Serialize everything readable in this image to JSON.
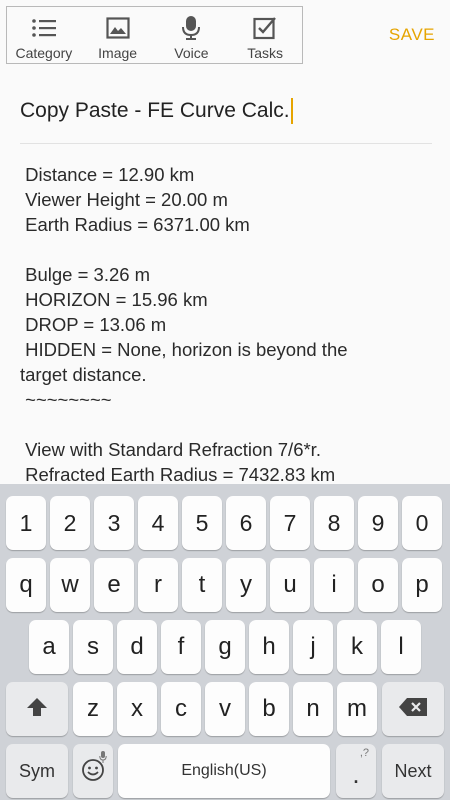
{
  "toolbar": {
    "items": [
      {
        "label": "Category",
        "icon": "list-icon"
      },
      {
        "label": "Image",
        "icon": "image-icon"
      },
      {
        "label": "Voice",
        "icon": "microphone-icon"
      },
      {
        "label": "Tasks",
        "icon": "checkbox-icon"
      }
    ],
    "save_label": "SAVE"
  },
  "note": {
    "title": "Copy Paste - FE Curve Calc.",
    "body": " Distance = 12.90 km\n Viewer Height = 20.00 m\n Earth Radius = 6371.00 km\n\n Bulge = 3.26 m\n HORIZON = 15.96 km\n DROP = 13.06 m\n HIDDEN = None, horizon is beyond the\ntarget distance.\n ~~~~~~~~\n\n View with Standard Refraction 7/6*r.\n Refracted Earth Radius = 7432.83 km"
  },
  "keyboard": {
    "row_numbers": [
      "1",
      "2",
      "3",
      "4",
      "5",
      "6",
      "7",
      "8",
      "9",
      "0"
    ],
    "row_top": [
      "q",
      "w",
      "e",
      "r",
      "t",
      "y",
      "u",
      "i",
      "o",
      "p"
    ],
    "row_mid": [
      "a",
      "s",
      "d",
      "f",
      "g",
      "h",
      "j",
      "k",
      "l"
    ],
    "row_bottom": [
      "z",
      "x",
      "c",
      "v",
      "b",
      "n",
      "m"
    ],
    "sym_label": "Sym",
    "space_label": "English(US)",
    "period_label": ".",
    "period_hint": ",?",
    "next_label": "Next"
  },
  "colors": {
    "accent": "#e6a400",
    "keyboard_bg": "#cfd2d7",
    "key_bg": "#fdfdfd",
    "function_key_bg": "#e9eaec"
  }
}
